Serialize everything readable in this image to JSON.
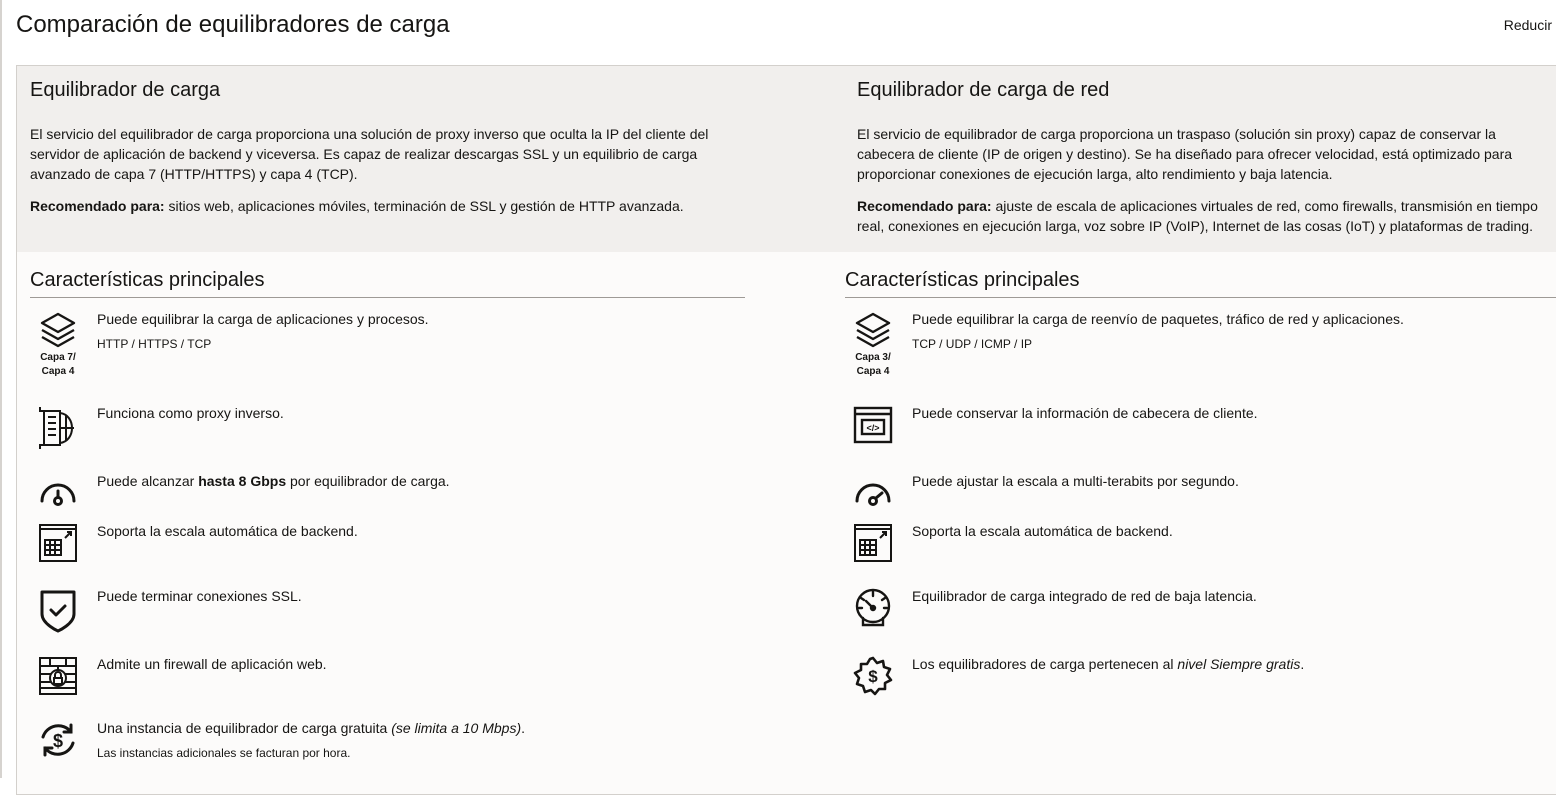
{
  "page": {
    "title": "Comparación de equilibradores de carga",
    "collapse_label": "Reducir"
  },
  "columns": [
    {
      "heading": "Equilibrador de carga",
      "description": "El servicio del equilibrador de carga proporciona una solución de proxy inverso que oculta la IP del cliente del servidor de aplicación de backend y viceversa. Es capaz de realizar descargas SSL y un equilibrio de carga avanzado de capa 7 (HTTP/HTTPS) y capa 4 (TCP).",
      "recommended_label": "Recomendado para:",
      "recommended_text": " sitios web, aplicaciones móviles, terminación de SSL y gestión de HTTP avanzada.",
      "features_heading": "Características principales",
      "features": [
        {
          "icon": "layers-icon",
          "icon_caption": "Capa 7/ Capa 4",
          "text": "Puede equilibrar la carga de aplicaciones y procesos.",
          "sub": "HTTP / HTTPS / TCP"
        },
        {
          "icon": "reverse-proxy-icon",
          "text": "Funciona como proxy inverso."
        },
        {
          "icon": "speedometer-icon",
          "text_before": "Puede alcanzar ",
          "text_bold": "hasta 8 Gbps",
          "text_after": " por equilibrador de carga."
        },
        {
          "icon": "autoscale-icon",
          "text": "Soporta la escala automática de backend."
        },
        {
          "icon": "shield-check-icon",
          "text": "Puede terminar conexiones SSL."
        },
        {
          "icon": "firewall-icon",
          "text": "Admite un firewall de aplicación web."
        },
        {
          "icon": "dollar-cycle-icon",
          "text": "Una instancia de equilibrador de carga gratuita ",
          "text_italic": "(se limita a 10 Mbps)",
          "text_after": ".",
          "sub": "Las instancias adicionales se facturan por hora."
        }
      ]
    },
    {
      "heading": "Equilibrador de carga de red",
      "description": "El servicio de equilibrador de carga proporciona un traspaso (solución sin proxy) capaz de conservar la cabecera de cliente (IP de origen y destino). Se ha diseñado para ofrecer velocidad, está optimizado para proporcionar conexiones de ejecución larga, alto rendimiento y baja latencia.",
      "recommended_label": "Recomendado para:",
      "recommended_text": " ajuste de escala de aplicaciones virtuales de red, como firewalls, transmisión en tiempo real, conexiones en ejecución larga, voz sobre IP (VoIP), Internet de las cosas (IoT) y plataformas de trading.",
      "features_heading": "Características principales",
      "features": [
        {
          "icon": "layers-icon",
          "icon_caption": "Capa 3/ Capa 4",
          "text": "Puede equilibrar la carga de reenvío de paquetes, tráfico de red y aplicaciones.",
          "sub": "TCP / UDP / ICMP / IP"
        },
        {
          "icon": "code-window-icon",
          "text": "Puede conservar la información de cabecera de cliente."
        },
        {
          "icon": "speedometer-icon",
          "text": "Puede ajustar la escala a multi-terabits por segundo."
        },
        {
          "icon": "autoscale-icon",
          "text": "Soporta la escala automática de backend."
        },
        {
          "icon": "gauge-icon",
          "text": "Equilibrador de carga integrado de red de baja latencia."
        },
        {
          "icon": "dollar-badge-icon",
          "text": "Los equilibradores de carga pertenecen al ",
          "text_italic": "nivel Siempre gratis",
          "text_after": "."
        }
      ]
    }
  ]
}
